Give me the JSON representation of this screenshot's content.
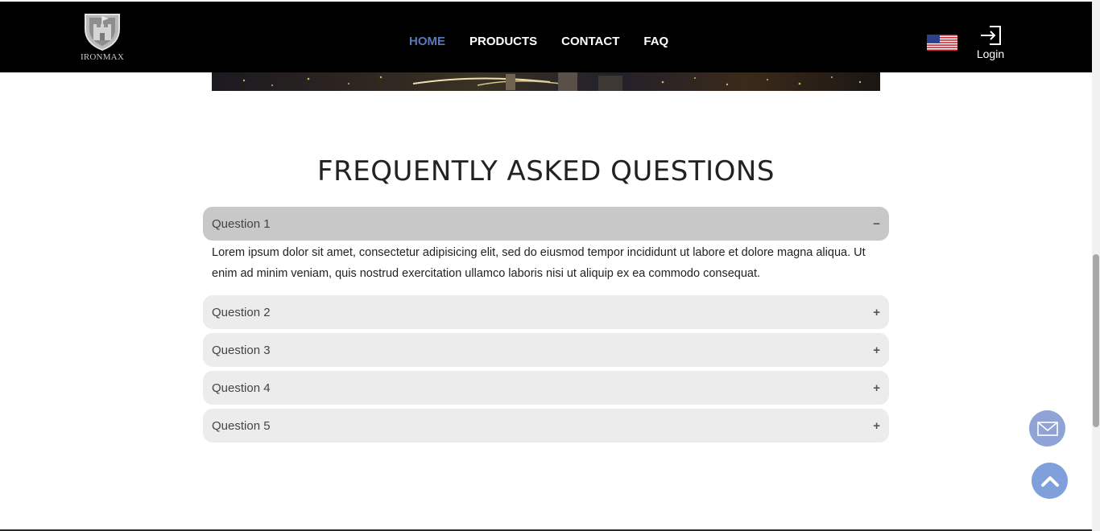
{
  "header": {
    "logo_text": "IRONMAX",
    "nav": [
      {
        "label": "HOME",
        "active": true
      },
      {
        "label": "PRODUCTS",
        "active": false
      },
      {
        "label": "CONTACT",
        "active": false
      },
      {
        "label": "FAQ",
        "active": false
      }
    ],
    "login_label": "Login",
    "language_flag": "us-flag-icon"
  },
  "faq": {
    "title": "FREQUENTLY ASKED QUESTIONS",
    "items": [
      {
        "question": "Question 1",
        "toggle": "−",
        "open": true,
        "answer": "Lorem ipsum dolor sit amet, consectetur adipisicing elit, sed do eiusmod tempor incididunt ut labore et dolore magna aliqua. Ut enim ad minim veniam, quis nostrud exercitation ullamco laboris nisi ut aliquip ex ea commodo consequat."
      },
      {
        "question": "Question 2",
        "toggle": "+",
        "open": false
      },
      {
        "question": "Question 3",
        "toggle": "+",
        "open": false
      },
      {
        "question": "Question 4",
        "toggle": "+",
        "open": false
      },
      {
        "question": "Question 5",
        "toggle": "+",
        "open": false
      }
    ]
  },
  "colors": {
    "header_bg": "#000000",
    "nav_active": "#5a78b8",
    "accordion_open": "#c8c8c8",
    "accordion_closed": "#ececec",
    "fab_blue": "#7fa0db"
  },
  "icons": {
    "mail_button": "mail-icon",
    "back_to_top": "chevron-up-icon",
    "login": "login-icon",
    "logo": "shield-logo-icon"
  }
}
